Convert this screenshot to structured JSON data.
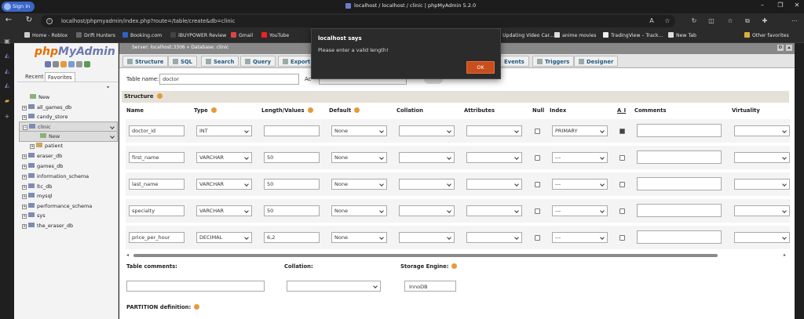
{
  "browser": {
    "signin_label": "Sign in",
    "window_title": "localhost / localhost / clinic | phpMyAdmin 5.2.0",
    "url": "localhost/phpmyadmin/index.php?route=/table/create&db=clinic",
    "bookmarks": [
      "Home - Roblox",
      "Drift Hunters",
      "Booking.com",
      "iBUYPOWER Review",
      "Gmail",
      "YouTube",
      "Updating Video Car...",
      "anime movies",
      "TradingView – Track...",
      "New Tab",
      "Other favorites"
    ]
  },
  "sidebar": {
    "logo_php": "php",
    "logo_myadmin": "MyAdmin",
    "tabs": [
      "Recent",
      "Favorites"
    ],
    "tree": [
      "New",
      "all_games_db",
      "candy_store",
      "clinic",
      "New",
      "patient",
      "eraser_db",
      "games_db",
      "information_schema",
      "ltc_db",
      "mysql",
      "performance_schema",
      "sys",
      "the_eraser_db"
    ]
  },
  "main": {
    "breadcrumb": "Server: localhost:3306 » Database: clinic",
    "tabs": [
      "Structure",
      "SQL",
      "Search",
      "Query",
      "Export",
      "Events",
      "Triggers",
      "Designer"
    ],
    "table_name_label": "Table name:",
    "table_name_value": "doctor",
    "add_label": "Ac",
    "structure_label": "Structure",
    "columns": [
      "Name",
      "Type",
      "Length/Values",
      "Default",
      "Collation",
      "Attributes",
      "Null",
      "Index",
      "A_I",
      "Comments",
      "Virtuality"
    ],
    "rows": [
      {
        "name": "doctor_id",
        "type": "INT",
        "length": "",
        "default": "None",
        "index": "PRIMARY",
        "ai": true
      },
      {
        "name": "first_name",
        "type": "VARCHAR",
        "length": "50",
        "default": "None",
        "index": "---",
        "ai": false
      },
      {
        "name": "last_name",
        "type": "VARCHAR",
        "length": "50",
        "default": "None",
        "index": "---",
        "ai": false
      },
      {
        "name": "specialty",
        "type": "VARCHAR",
        "length": "50",
        "default": "None",
        "index": "---",
        "ai": false
      },
      {
        "name": "price_per_hour",
        "type": "DECIMAL",
        "length": "6,2",
        "default": "None",
        "index": "---",
        "ai": false
      }
    ],
    "table_comments_label": "Table comments:",
    "collation_label": "Collation:",
    "storage_engine_label": "Storage Engine:",
    "storage_engine_value": "InnoDB",
    "partition_label": "PARTITION definition:"
  },
  "dialog": {
    "title": "localhost says",
    "message": "Please enter a valid length!",
    "ok_label": "OK"
  },
  "colors": {
    "accent_dialog": "#c84e1c",
    "pma_orange": "#e76f00",
    "pma_blue": "#6c78af"
  }
}
